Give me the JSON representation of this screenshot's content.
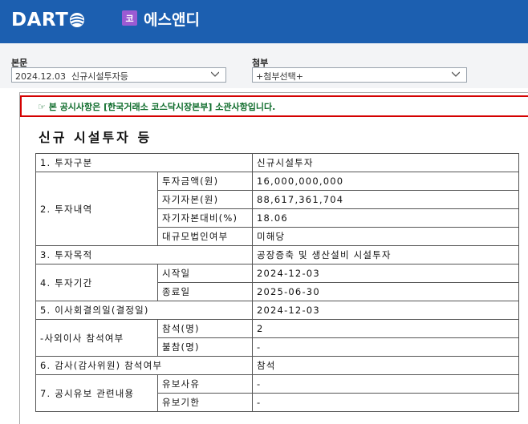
{
  "header": {
    "logo_text": "DART",
    "company_badge": "코",
    "company_name": "에스앤디"
  },
  "selectors": {
    "body_label": "본문",
    "body_value": "2024.12.03  신규시설투자등",
    "attach_label": "첨부",
    "attach_value": "+첨부선택+"
  },
  "notice": {
    "icon": "☞",
    "text": "본 공시사항은 [한국거래소 코스닥시장본부] 소관사항입니다."
  },
  "document": {
    "title": "신규 시설투자 등",
    "rows": {
      "r1": {
        "label": "1. 투자구분",
        "value": "신규시설투자"
      },
      "r2": {
        "label": "2. 투자내역",
        "sub": [
          {
            "label": "투자금액(원)",
            "value": "16,000,000,000"
          },
          {
            "label": "자기자본(원)",
            "value": "88,617,361,704"
          },
          {
            "label": "자기자본대비(%)",
            "value": "18.06"
          },
          {
            "label": "대규모법인여부",
            "value": "미해당"
          }
        ]
      },
      "r3": {
        "label": "3. 투자목적",
        "value": "공장증축 및 생산설비 시설투자"
      },
      "r4": {
        "label": "4. 투자기간",
        "sub": [
          {
            "label": "시작일",
            "value": "2024-12-03"
          },
          {
            "label": "종료일",
            "value": "2025-06-30"
          }
        ]
      },
      "r5": {
        "label": "5. 이사회결의일(결정일)",
        "value": "2024-12-03"
      },
      "r6": {
        "label": "-사외이사 참석여부",
        "sub": [
          {
            "label": "참석(명)",
            "value": "2"
          },
          {
            "label": "불참(명)",
            "value": "-"
          }
        ]
      },
      "r7": {
        "label": "6. 감사(감사위원) 참석여부",
        "value": "참석"
      },
      "r8": {
        "label": "7. 공시유보 관련내용",
        "sub": [
          {
            "label": "유보사유",
            "value": "-"
          },
          {
            "label": "유보기한",
            "value": "-"
          }
        ]
      }
    }
  },
  "colors": {
    "header_bg": "#1c5fb0",
    "badge_bg": "#9b5bd3",
    "notice_border": "#d40000",
    "notice_text": "#0d6b2a"
  }
}
